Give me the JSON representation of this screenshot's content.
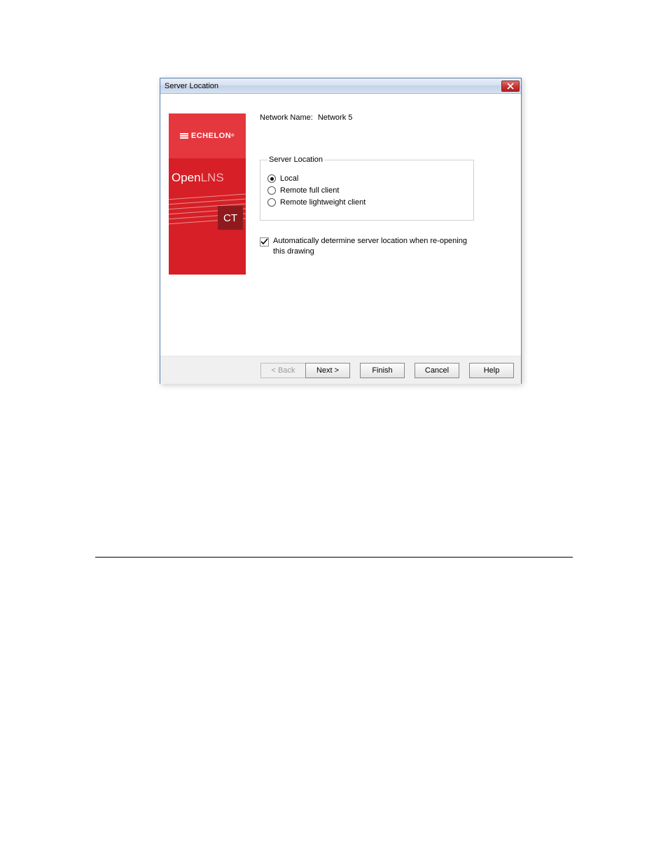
{
  "dialog": {
    "title": "Server Location",
    "networkNameLabel": "Network Name:",
    "networkNameValue": "Network 5",
    "serverLocationLegend": "Server Location",
    "radios": [
      {
        "label": "Local",
        "checked": true
      },
      {
        "label": "Remote full client",
        "checked": false
      },
      {
        "label": "Remote lightweight client",
        "checked": false
      }
    ],
    "autoDetermine": {
      "checked": true,
      "label": "Automatically determine server location when re-opening this drawing"
    },
    "buttons": {
      "back": "< Back",
      "next": "Next >",
      "finish": "Finish",
      "cancel": "Cancel",
      "help": "Help"
    }
  },
  "brand": {
    "echelon": "ECHELON",
    "open": "Open",
    "lns": "LNS",
    "ct": "CT"
  }
}
